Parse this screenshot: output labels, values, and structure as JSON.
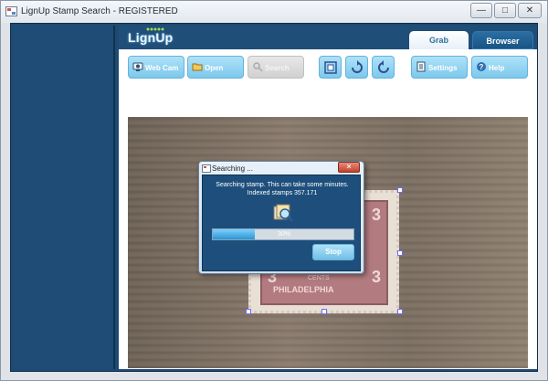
{
  "window": {
    "title": "LignUp Stamp Search - REGISTERED",
    "controls": {
      "minimize": "—",
      "maximize": "□",
      "close": "✕"
    }
  },
  "logo": {
    "text": "LignUp"
  },
  "tabs": [
    {
      "label": "Grab",
      "active": true
    },
    {
      "label": "Browser",
      "active": false
    }
  ],
  "toolbar": {
    "webcam": "Web Cam",
    "open": "Open",
    "search": "Search",
    "settings": "Settings",
    "help": "Help"
  },
  "dialog": {
    "title": "Searching ...",
    "close_symbol": "✕",
    "message_line1": "Searching stamp. This can take some minutes.",
    "message_line2": "Indexed stamps 357.171",
    "progress_percent": 30,
    "progress_text": "30%",
    "stop_label": "Stop"
  },
  "stamp": {
    "numbers": [
      "3",
      "3",
      "3",
      "3"
    ],
    "text": "PHILADELPHIA",
    "cents": "CENTS"
  },
  "colors": {
    "accent": "#7dc8ec",
    "frame": "#1f4e79",
    "progress": "#2d94d1"
  }
}
